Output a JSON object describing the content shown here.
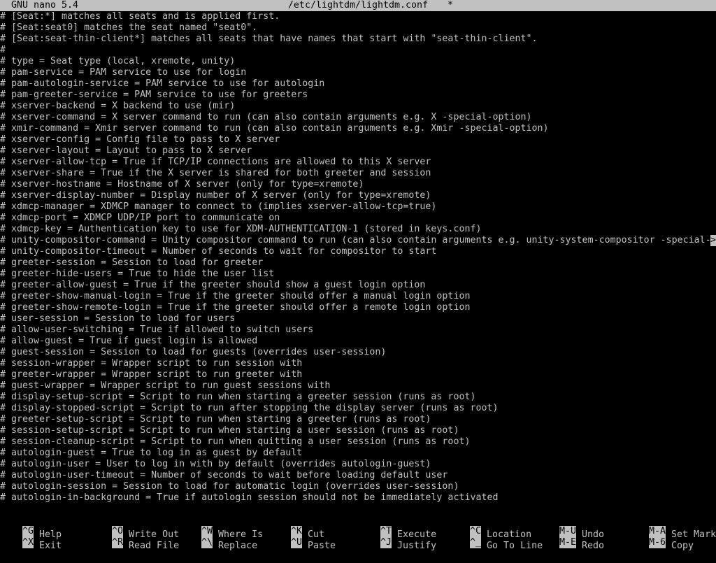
{
  "titlebar": {
    "app": "GNU nano 5.4",
    "file": "/etc/lightdm/lightdm.conf",
    "modified": "*"
  },
  "editor": {
    "lines": [
      "# [Seat:*] matches all seats and is applied first.",
      "# [Seat:seat0] matches the seat named \"seat0\".",
      "# [Seat:seat-thin-client*] matches all seats that have names that start with \"seat-thin-client\".",
      "#",
      "# type = Seat type (local, xremote, unity)",
      "# pam-service = PAM service to use for login",
      "# pam-autologin-service = PAM service to use for autologin",
      "# pam-greeter-service = PAM service to use for greeters",
      "# xserver-backend = X backend to use (mir)",
      "# xserver-command = X server command to run (can also contain arguments e.g. X -special-option)",
      "# xmir-command = Xmir server command to run (can also contain arguments e.g. Xmir -special-option)",
      "# xserver-config = Config file to pass to X server",
      "# xserver-layout = Layout to pass to X server",
      "# xserver-allow-tcp = True if TCP/IP connections are allowed to this X server",
      "# xserver-share = True if the X server is shared for both greeter and session",
      "# xserver-hostname = Hostname of X server (only for type=xremote)",
      "# xserver-display-number = Display number of X server (only for type=xremote)",
      "# xdmcp-manager = XDMCP manager to connect to (implies xserver-allow-tcp=true)",
      "# xdmcp-port = XDMCP UDP/IP port to communicate on",
      "# xdmcp-key = Authentication key to use for XDM-AUTHENTICATION-1 (stored in keys.conf)",
      "# unity-compositor-command = Unity compositor command to run (can also contain arguments e.g. unity-system-compositor -special-",
      "# unity-compositor-timeout = Number of seconds to wait for compositor to start",
      "# greeter-session = Session to load for greeter",
      "# greeter-hide-users = True to hide the user list",
      "# greeter-allow-guest = True if the greeter should show a guest login option",
      "# greeter-show-manual-login = True if the greeter should offer a manual login option",
      "# greeter-show-remote-login = True if the greeter should offer a remote login option",
      "# user-session = Session to load for users",
      "# allow-user-switching = True if allowed to switch users",
      "# allow-guest = True if guest login is allowed",
      "# guest-session = Session to load for guests (overrides user-session)",
      "# session-wrapper = Wrapper script to run session with",
      "# greeter-wrapper = Wrapper script to run greeter with",
      "# guest-wrapper = Wrapper script to run guest sessions with",
      "# display-setup-script = Script to run when starting a greeter session (runs as root)",
      "# display-stopped-script = Script to run after stopping the display server (runs as root)",
      "# greeter-setup-script = Script to run when starting a greeter (runs as root)",
      "# session-setup-script = Script to run when starting a user session (runs as root)",
      "# session-cleanup-script = Script to run when quitting a user session (runs as root)",
      "# autologin-guest = True to log in as guest by default",
      "# autologin-user = User to log in with by default (overrides autologin-guest)",
      "# autologin-user-timeout = Number of seconds to wait before loading default user",
      "# autologin-session = Session to load for automatic login (overrides user-session)",
      "# autologin-in-background = True if autologin session should not be immediately activated"
    ],
    "overflow_marker": ">"
  },
  "shortcuts": {
    "help": {
      "key": "^G",
      "label": "Help"
    },
    "exit": {
      "key": "^X",
      "label": "Exit"
    },
    "write_out": {
      "key": "^O",
      "label": "Write Out"
    },
    "read_file": {
      "key": "^R",
      "label": "Read File"
    },
    "where_is": {
      "key": "^W",
      "label": "Where Is"
    },
    "replace": {
      "key": "^\\",
      "label": "Replace"
    },
    "cut": {
      "key": "^K",
      "label": "Cut"
    },
    "paste": {
      "key": "^U",
      "label": "Paste"
    },
    "execute": {
      "key": "^T",
      "label": "Execute"
    },
    "justify": {
      "key": "^J",
      "label": "Justify"
    },
    "location": {
      "key": "^C",
      "label": "Location"
    },
    "go_to_line": {
      "key": "^_",
      "label": "Go To Line"
    },
    "undo": {
      "key": "M-U",
      "label": "Undo"
    },
    "redo": {
      "key": "M-E",
      "label": "Redo"
    },
    "set_mark": {
      "key": "M-A",
      "label": "Set Mark"
    },
    "copy": {
      "key": "M-6",
      "label": "Copy"
    }
  },
  "colors": {
    "background": "#000000",
    "foreground": "#c0c0c0",
    "inverse_bg": "#c0c0c0",
    "inverse_fg": "#000000"
  }
}
